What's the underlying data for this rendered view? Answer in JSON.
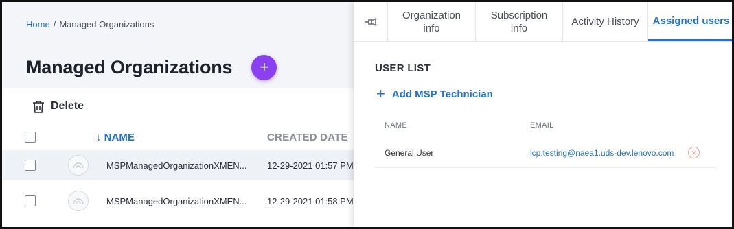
{
  "breadcrumb": {
    "home": "Home",
    "separator": "/",
    "current": "Managed Organizations"
  },
  "page": {
    "title": "Managed Organizations",
    "add_icon": "+"
  },
  "toolbar": {
    "delete_label": "Delete",
    "delete_icon": "trash-icon"
  },
  "table": {
    "columns": {
      "name": "NAME",
      "name_sort_icon": "↓",
      "created": "CREATED DATE"
    },
    "rows": [
      {
        "name": "MSPManagedOrganizationXMEN...",
        "created": "12-29-2021 01:57 PM"
      },
      {
        "name": "MSPManagedOrganizationXMEN...",
        "created": "12-29-2021 01:58 PM"
      }
    ]
  },
  "drawer": {
    "tabs": [
      {
        "label": "Organization info"
      },
      {
        "label": "Subscription info"
      },
      {
        "label": "Activity History"
      },
      {
        "label": "Assigned users",
        "active": true
      }
    ],
    "pin_icon": "pin-icon",
    "section_title": "USER LIST",
    "add_label": "Add MSP Technician",
    "add_icon": "+",
    "user_table": {
      "columns": {
        "name": "NAME",
        "email": "EMAIL"
      },
      "rows": [
        {
          "name": "General User",
          "email": "lcp.testing@naea1.uds-dev.lenovo.com",
          "remove_icon": "×"
        }
      ]
    }
  },
  "colors": {
    "accent": "#1f6fd6",
    "add_button": "#8a3ff0",
    "remove": "#f08a8a",
    "panel_bg": "#f3f5f8"
  }
}
